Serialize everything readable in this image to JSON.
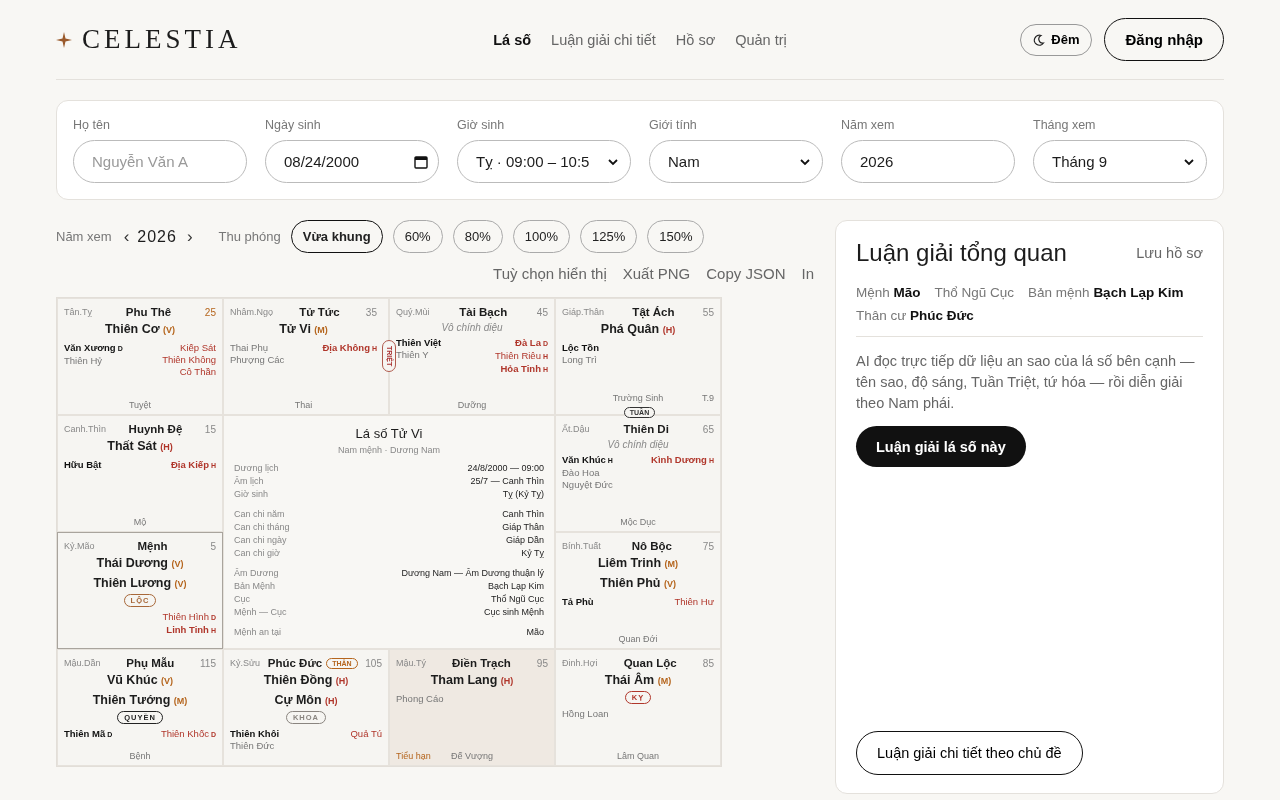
{
  "header": {
    "logo": "CELESTIA",
    "nav": [
      {
        "label": "Lá số",
        "selected": true
      },
      {
        "label": "Luận giải chi tiết",
        "selected": false
      },
      {
        "label": "Hồ sơ",
        "selected": false
      },
      {
        "label": "Quản trị",
        "selected": false
      }
    ],
    "theme_button": "Đêm",
    "login_button": "Đăng nhập"
  },
  "form": {
    "fields": [
      {
        "label": "Họ tên",
        "kind": "text",
        "placeholder": "Nguyễn Văn A"
      },
      {
        "label": "Ngày sinh",
        "kind": "date",
        "value": "08/24/2000"
      },
      {
        "label": "Giờ sinh",
        "kind": "select",
        "value": "Tỵ · 09:00 – 10:5"
      },
      {
        "label": "Giới tính",
        "kind": "select",
        "value": "Nam"
      },
      {
        "label": "Năm xem",
        "kind": "text",
        "value": "2026"
      },
      {
        "label": "Tháng xem",
        "kind": "select",
        "value": "Tháng 9"
      }
    ]
  },
  "toolbar": {
    "year_label": "Năm xem",
    "prev": "‹",
    "year": "2026",
    "next": "›",
    "zoom_label": "Thu phóng",
    "zoom_options": [
      {
        "label": "Vừa khung",
        "selected": true
      },
      {
        "label": "60%",
        "selected": false
      },
      {
        "label": "80%",
        "selected": false
      },
      {
        "label": "100%",
        "selected": false
      },
      {
        "label": "125%",
        "selected": false
      },
      {
        "label": "150%",
        "selected": false
      }
    ],
    "actions": [
      "Tuỳ chọn hiển thị",
      "Xuất PNG",
      "Copy JSON",
      "In"
    ]
  },
  "chart": {
    "cells": [
      {
        "can_chi": "Tân.Tỵ",
        "palace": "Phu Thê",
        "age": "25",
        "selected": false,
        "current_year": false,
        "main_stars": [
          {
            "name": "Thiên Cơ",
            "brightness": "(V)",
            "color": "#b5651d"
          }
        ],
        "good": [
          {
            "name": "Văn Xương",
            "grade": "D",
            "strong": true
          },
          {
            "name": "Thiên Hỷ",
            "strong": false
          }
        ],
        "bad": [
          {
            "name": "Kiếp Sát",
            "strong": false
          },
          {
            "name": "Thiên Không",
            "strong": false
          },
          {
            "name": "Cô Thần",
            "strong": false
          }
        ],
        "stage": "Tuyệt"
      },
      {
        "can_chi": "Nhâm.Ngọ",
        "palace": "Tử Tức",
        "age": "35",
        "selected": false,
        "current_year": false,
        "main_stars": [
          {
            "name": "Tử Vi",
            "brightness": "(M)",
            "color": "#b5651d"
          }
        ],
        "good": [
          {
            "name": "Thai Phụ",
            "strong": false
          },
          {
            "name": "Phượng Các",
            "strong": false
          }
        ],
        "bad": [
          {
            "name": "Địa Không",
            "grade": "H",
            "strong": true
          }
        ],
        "stage": "Thai",
        "side_mark": "TRIỆT"
      },
      {
        "can_chi": "Quý.Mùi",
        "palace": "Tài Bạch",
        "age": "45",
        "selected": false,
        "current_year": false,
        "no_main": "Vô chính diệu",
        "good": [
          {
            "name": "Thiên Việt",
            "strong": true
          },
          {
            "name": "Thiên Y",
            "strong": false
          }
        ],
        "bad": [
          {
            "name": "Đà La",
            "grade": "D",
            "strong": true
          },
          {
            "name": "Thiên Riêu",
            "grade": "H",
            "strong": false
          },
          {
            "name": "Hỏa Tinh",
            "grade": "H",
            "strong": true
          }
        ],
        "stage": "Dưỡng"
      },
      {
        "can_chi": "Giáp.Thân",
        "palace": "Tật Ách",
        "age": "55",
        "selected": false,
        "current_year": false,
        "main_stars": [
          {
            "name": "Phá Quân",
            "brightness": "(H)",
            "color": "#b0362b"
          }
        ],
        "good": [
          {
            "name": "Lộc Tồn",
            "strong": true
          },
          {
            "name": "Long Trì",
            "strong": false
          }
        ],
        "stage": "Trường Sinh",
        "corner_right": "T.9",
        "bottom_mark": "TUẦN"
      },
      {
        "can_chi": "Canh.Thìn",
        "palace": "Huynh Đệ",
        "age": "15",
        "selected": false,
        "current_year": false,
        "main_stars": [
          {
            "name": "Thất Sát",
            "brightness": "(H)",
            "color": "#b0362b"
          }
        ],
        "good": [
          {
            "name": "Hữu Bật",
            "strong": true
          }
        ],
        "bad": [
          {
            "name": "Địa Kiếp",
            "grade": "H",
            "strong": true
          }
        ],
        "stage": "Mộ"
      },
      {
        "can_chi": "Ất.Dậu",
        "palace": "Thiên Di",
        "age": "65",
        "selected": false,
        "current_year": false,
        "no_main": "Vô chính diệu",
        "good": [
          {
            "name": "Văn Khúc",
            "grade": "H",
            "strong": true
          },
          {
            "name": "Đào Hoa",
            "strong": false
          },
          {
            "name": "Nguyệt Đức",
            "strong": false
          }
        ],
        "bad": [
          {
            "name": "Kình Dương",
            "grade": "H",
            "strong": true
          }
        ],
        "stage": "Mộc Dục"
      },
      {
        "can_chi": "Kỷ.Mão",
        "palace": "Mệnh",
        "age": "5",
        "selected": true,
        "current_year": false,
        "main_stars": [
          {
            "name": "Thái Dương",
            "brightness": "(V)",
            "color": "#b5651d"
          },
          {
            "name": "Thiên Lương",
            "brightness": "(V)",
            "color": "#b5651d"
          }
        ],
        "tag": {
          "label": "LỘC",
          "color": "#a8683a"
        },
        "bad": [
          {
            "name": "Thiên Hình",
            "grade": "D",
            "strong": false
          },
          {
            "name": "Linh Tinh",
            "grade": "H",
            "strong": true
          }
        ]
      },
      {
        "can_chi": "Bính.Tuất",
        "palace": "Nô Bộc",
        "age": "75",
        "selected": false,
        "current_year": false,
        "main_stars": [
          {
            "name": "Liêm Trinh",
            "brightness": "(M)",
            "color": "#b5651d"
          },
          {
            "name": "Thiên Phủ",
            "brightness": "(V)",
            "color": "#b5651d"
          }
        ],
        "good": [
          {
            "name": "Tả Phù",
            "strong": true
          }
        ],
        "bad": [
          {
            "name": "Thiên Hư",
            "strong": false
          }
        ],
        "stage": "Quan Đới"
      },
      {
        "can_chi": "Mậu.Dần",
        "palace": "Phụ Mẫu",
        "age": "115",
        "selected": false,
        "current_year": false,
        "main_stars": [
          {
            "name": "Vũ Khúc",
            "brightness": "(V)",
            "color": "#b5651d"
          },
          {
            "name": "Thiên Tướng",
            "brightness": "(M)",
            "color": "#b5651d"
          }
        ],
        "tag": {
          "label": "QUYỀN",
          "color": "#222222"
        },
        "good": [
          {
            "name": "Thiên Mã",
            "grade": "D",
            "strong": true
          }
        ],
        "bad": [
          {
            "name": "Thiên Khốc",
            "grade": "D",
            "strong": false
          }
        ],
        "stage": "Bệnh"
      },
      {
        "can_chi": "Kỷ.Sửu",
        "palace": "Phúc Đức",
        "age": "105",
        "selected": false,
        "current_year": false,
        "badge": "THÂN",
        "main_stars": [
          {
            "name": "Thiên Đồng",
            "brightness": "(H)",
            "color": "#b0362b"
          },
          {
            "name": "Cự Môn",
            "brightness": "(H)",
            "color": "#b0362b"
          }
        ],
        "tag": {
          "label": "KHOA",
          "color": "#8a8580"
        },
        "good": [
          {
            "name": "Thiên Khôi",
            "strong": true
          },
          {
            "name": "Thiên Đức",
            "strong": false
          }
        ],
        "bad": [
          {
            "name": "Quả Tú",
            "strong": false
          }
        ]
      },
      {
        "can_chi": "Mậu.Tý",
        "palace": "Điền Trạch",
        "age": "95",
        "selected": false,
        "current_year": true,
        "main_stars": [
          {
            "name": "Tham Lang",
            "brightness": "(H)",
            "color": "#b0362b"
          }
        ],
        "good": [
          {
            "name": "Phong Cáo",
            "strong": false
          }
        ],
        "stage": "Đế Vượng",
        "corner_left": "Tiểu hạn"
      },
      {
        "can_chi": "Đinh.Hợi",
        "palace": "Quan Lộc",
        "age": "85",
        "selected": false,
        "current_year": false,
        "main_stars": [
          {
            "name": "Thái Âm",
            "brightness": "(M)",
            "color": "#b5651d"
          }
        ],
        "tag": {
          "label": "KỴ",
          "color": "#b0362b"
        },
        "good": [
          {
            "name": "Hồng Loan",
            "strong": false
          }
        ],
        "stage": "Lâm Quan"
      }
    ],
    "center": {
      "title": "Lá số Tử Vi",
      "subtitle": "Nam mệnh · Dương Nam",
      "groups": [
        [
          {
            "label": "Dương lịch",
            "value": "24/8/2000 — 09:00"
          },
          {
            "label": "Âm lịch",
            "value": "25/7 — Canh Thìn"
          },
          {
            "label": "Giờ sinh",
            "value": "Tỵ (Kỷ Tỵ)"
          }
        ],
        [
          {
            "label": "Can chi năm",
            "value": "Canh Thìn"
          },
          {
            "label": "Can chi tháng",
            "value": "Giáp Thân"
          },
          {
            "label": "Can chi ngày",
            "value": "Giáp Dần"
          },
          {
            "label": "Can chi giờ",
            "value": "Kỷ Tỵ"
          }
        ],
        [
          {
            "label": "Âm Dương",
            "value": "Dương Nam — Âm Dương thuận lý"
          },
          {
            "label": "Bản Mệnh",
            "value": "Bạch Lạp Kim"
          },
          {
            "label": "Cục",
            "value": "Thổ Ngũ Cục"
          },
          {
            "label": "Mệnh — Cục",
            "value": "Cục sinh Mệnh"
          }
        ],
        [
          {
            "label": "Mệnh an tại",
            "value": "Mão"
          }
        ]
      ]
    }
  },
  "panel": {
    "title": "Luận giải tổng quan",
    "save_link": "Lưu hồ sơ",
    "facts": [
      "Mệnh **Mão**",
      "Thổ Ngũ Cục",
      "Bản mệnh **Bạch Lạp Kim**"
    ],
    "facts2": [
      "Thân cư **Phúc Đức**"
    ],
    "description": "AI đọc trực tiếp dữ liệu an sao của lá số bên cạnh — tên sao, độ sáng, Tuần Triệt, tứ hóa — rồi diễn giải theo Nam phái.",
    "primary_button": "Luận giải lá số này",
    "secondary_button": "Luận giải chi tiết theo chủ đề"
  }
}
